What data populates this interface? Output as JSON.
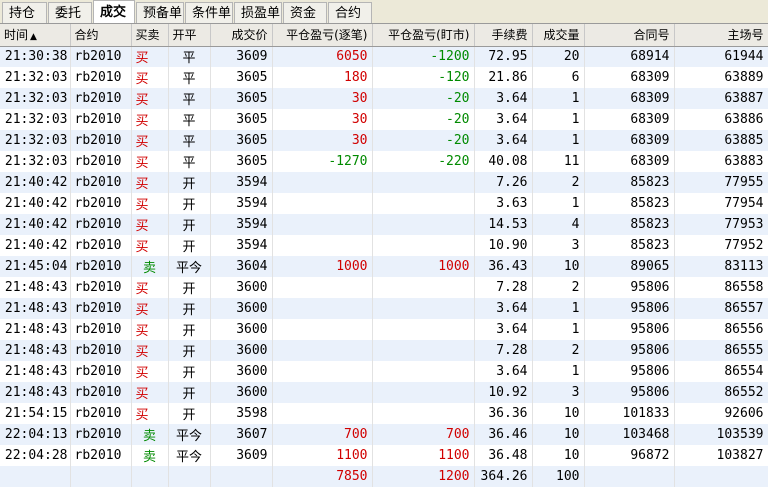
{
  "tabs": [
    {
      "label": "持仓",
      "active": false
    },
    {
      "label": "委托",
      "active": false
    },
    {
      "label": "成交",
      "active": true
    },
    {
      "label": "预备单",
      "active": false
    },
    {
      "label": "条件单",
      "active": false
    },
    {
      "label": "损盈单",
      "active": false
    },
    {
      "label": "资金",
      "active": false
    },
    {
      "label": "合约",
      "active": false
    }
  ],
  "columns": {
    "time": "时间",
    "sort_icon": "▲",
    "contract": "合约",
    "direction": "买卖",
    "open_close": "开平",
    "price": "成交价",
    "pnl_trade": "平仓盈亏(逐笔)",
    "pnl_mtm": "平仓盈亏(盯市)",
    "fee": "手续费",
    "volume": "成交量",
    "contract_no": "合同号",
    "exchange_no": "主场号"
  },
  "rows": [
    [
      "21:30:38",
      "rb2010",
      "买",
      "平",
      "3609",
      "6050",
      "-1200",
      "72.95",
      "20",
      "68914",
      "61944"
    ],
    [
      "21:32:03",
      "rb2010",
      "买",
      "平",
      "3605",
      "180",
      "-120",
      "21.86",
      "6",
      "68309",
      "63889"
    ],
    [
      "21:32:03",
      "rb2010",
      "买",
      "平",
      "3605",
      "30",
      "-20",
      "3.64",
      "1",
      "68309",
      "63887"
    ],
    [
      "21:32:03",
      "rb2010",
      "买",
      "平",
      "3605",
      "30",
      "-20",
      "3.64",
      "1",
      "68309",
      "63886"
    ],
    [
      "21:32:03",
      "rb2010",
      "买",
      "平",
      "3605",
      "30",
      "-20",
      "3.64",
      "1",
      "68309",
      "63885"
    ],
    [
      "21:32:03",
      "rb2010",
      "买",
      "平",
      "3605",
      "-1270",
      "-220",
      "40.08",
      "11",
      "68309",
      "63883"
    ],
    [
      "21:40:42",
      "rb2010",
      "买",
      "开",
      "3594",
      "",
      "",
      "7.26",
      "2",
      "85823",
      "77955"
    ],
    [
      "21:40:42",
      "rb2010",
      "买",
      "开",
      "3594",
      "",
      "",
      "3.63",
      "1",
      "85823",
      "77954"
    ],
    [
      "21:40:42",
      "rb2010",
      "买",
      "开",
      "3594",
      "",
      "",
      "14.53",
      "4",
      "85823",
      "77953"
    ],
    [
      "21:40:42",
      "rb2010",
      "买",
      "开",
      "3594",
      "",
      "",
      "10.90",
      "3",
      "85823",
      "77952"
    ],
    [
      "21:45:04",
      "rb2010",
      "卖",
      "平今",
      "3604",
      "1000",
      "1000",
      "36.43",
      "10",
      "89065",
      "83113"
    ],
    [
      "21:48:43",
      "rb2010",
      "买",
      "开",
      "3600",
      "",
      "",
      "7.28",
      "2",
      "95806",
      "86558"
    ],
    [
      "21:48:43",
      "rb2010",
      "买",
      "开",
      "3600",
      "",
      "",
      "3.64",
      "1",
      "95806",
      "86557"
    ],
    [
      "21:48:43",
      "rb2010",
      "买",
      "开",
      "3600",
      "",
      "",
      "3.64",
      "1",
      "95806",
      "86556"
    ],
    [
      "21:48:43",
      "rb2010",
      "买",
      "开",
      "3600",
      "",
      "",
      "7.28",
      "2",
      "95806",
      "86555"
    ],
    [
      "21:48:43",
      "rb2010",
      "买",
      "开",
      "3600",
      "",
      "",
      "3.64",
      "1",
      "95806",
      "86554"
    ],
    [
      "21:48:43",
      "rb2010",
      "买",
      "开",
      "3600",
      "",
      "",
      "10.92",
      "3",
      "95806",
      "86552"
    ],
    [
      "21:54:15",
      "rb2010",
      "买",
      "开",
      "3598",
      "",
      "",
      "36.36",
      "10",
      "101833",
      "92606"
    ],
    [
      "22:04:13",
      "rb2010",
      "卖",
      "平今",
      "3607",
      "700",
      "700",
      "36.46",
      "10",
      "103468",
      "103539"
    ],
    [
      "22:04:28",
      "rb2010",
      "卖",
      "平今",
      "3609",
      "1100",
      "1100",
      "36.48",
      "10",
      "96872",
      "103827"
    ]
  ],
  "totals": {
    "pnl_trade": "7850",
    "pnl_mtm": "1200",
    "fee": "364.26",
    "volume": "100"
  },
  "colors": {
    "buy": "#d10000",
    "sell": "#008a00",
    "profit": "#d10000",
    "loss": "#008a00",
    "row_alt": "#eaf1fb"
  }
}
